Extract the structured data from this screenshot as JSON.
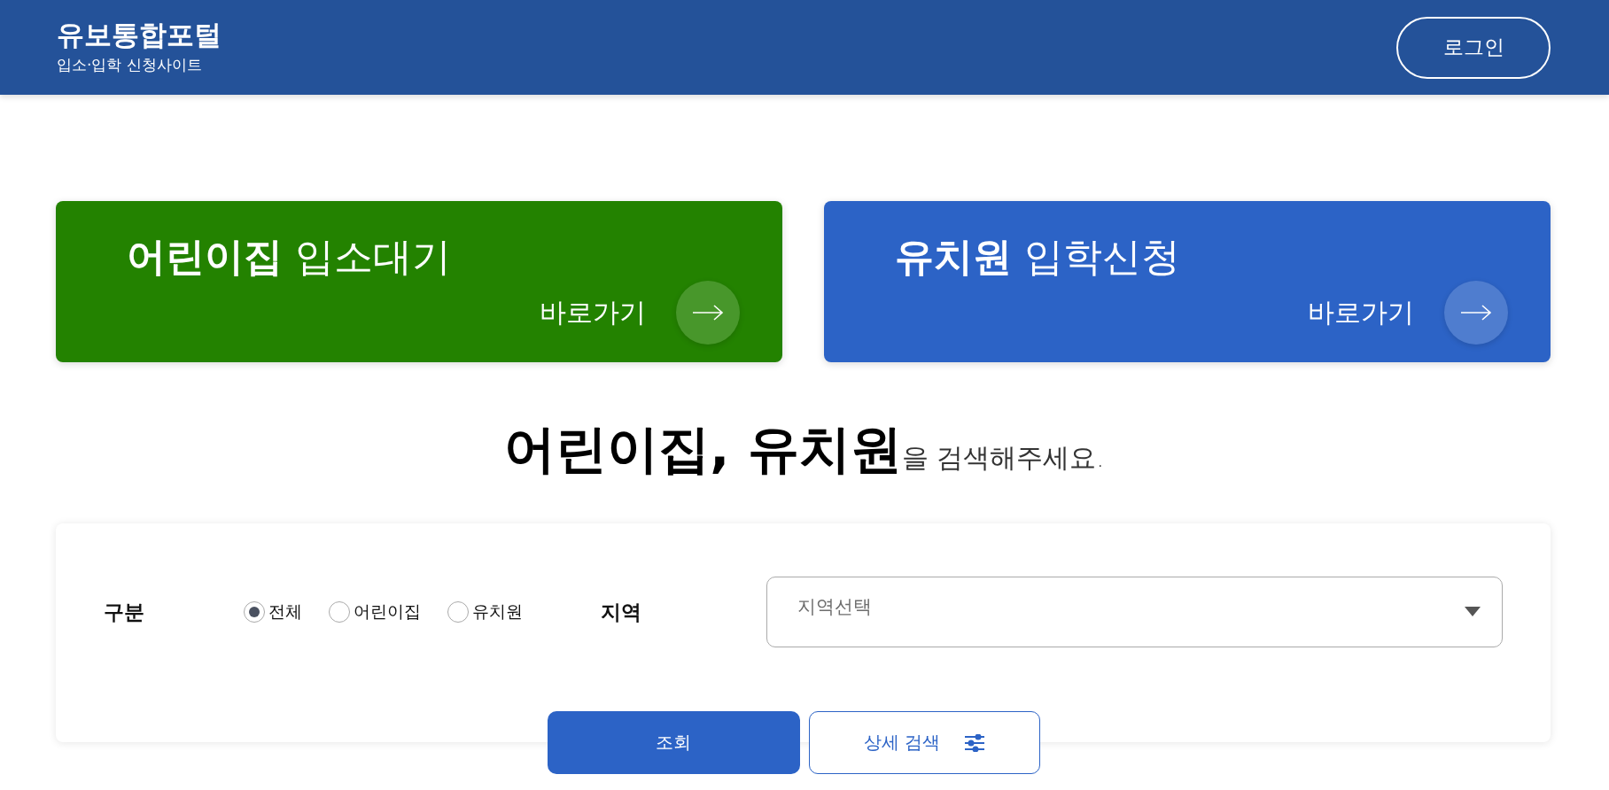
{
  "header": {
    "title": "유보통합포털",
    "subtitle": "입소·입학 신청사이트",
    "login_button": "로그인"
  },
  "cards": [
    {
      "kind": "daycare",
      "bold": "어린이집",
      "rest": "입소대기",
      "link": "바로가기"
    },
    {
      "kind": "kindergarten",
      "bold": "유치원",
      "rest": "입학신청",
      "link": "바로가기"
    }
  ],
  "heading": {
    "bold": "어린이집, 유치원",
    "rest": "을 검색해주세요."
  },
  "search": {
    "type_label": "구분",
    "options": [
      {
        "label": "전체",
        "selected": true
      },
      {
        "label": "어린이집",
        "selected": false
      },
      {
        "label": "유치원",
        "selected": false
      }
    ],
    "region_label": "지역",
    "region_select": {
      "placeholder": "지역선택"
    },
    "search_button": "조회",
    "detail_button": "상세 검색"
  }
}
